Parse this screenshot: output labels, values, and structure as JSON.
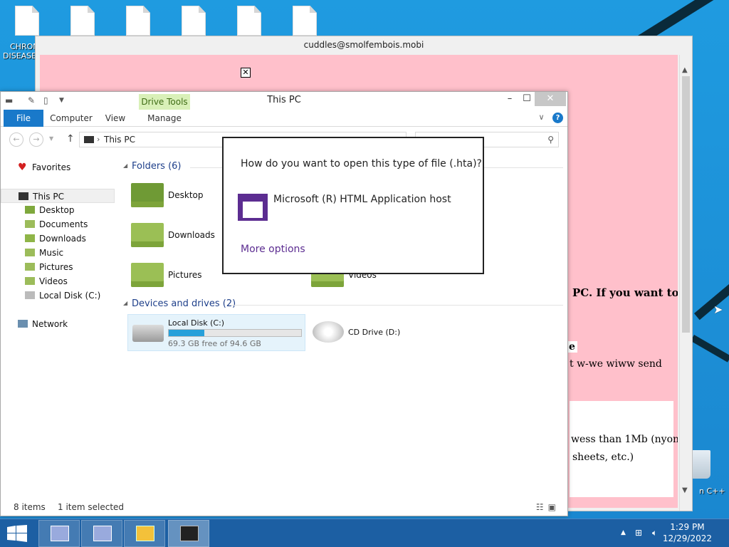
{
  "desktop": {
    "left_labels": [
      "CHRON",
      "DISEASE"
    ],
    "partial_label": "n C++"
  },
  "hta_window": {
    "title": "cuddles@smolfembois.mobi",
    "close_box_icon": "boxed-x-icon",
    "fragments": {
      "line1": "PC. If you want to",
      "line2": "e",
      "line3": "t w-we wiww send",
      "line4": "wess than 1Mb (nyon",
      "line5": "sheets, etc.)"
    }
  },
  "explorer": {
    "title": "This PC",
    "contextual_tab": "Drive Tools",
    "ribbon_tabs": [
      "File",
      "Computer",
      "View",
      "Manage"
    ],
    "address_path": "This PC",
    "navigation": {
      "favorites": "Favorites",
      "this_pc": "This PC",
      "items": [
        "Desktop",
        "Documents",
        "Downloads",
        "Music",
        "Pictures",
        "Videos",
        "Local Disk (C:)"
      ],
      "network": "Network"
    },
    "folders_header": "Folders (6)",
    "folders": [
      "Desktop",
      "Downloads",
      "Pictures",
      "Videos"
    ],
    "devices_header": "Devices and drives (2)",
    "drives": {
      "local_name": "Local Disk (C:)",
      "local_free": "69.3 GB free of 94.6 GB",
      "local_used_fraction": 0.27,
      "cd_name": "CD Drive (D:)"
    },
    "status": {
      "items": "8 items",
      "selected": "1 item selected"
    }
  },
  "dialog": {
    "question": "How do you want to open this type of file (.hta)?",
    "app_name": "Microsoft (R) HTML Application host",
    "more_options": "More options"
  },
  "taskbar": {
    "time": "1:29 PM",
    "date": "12/29/2022"
  },
  "colors": {
    "accent": "#1979ca",
    "dialog_accent": "#5c2d91",
    "hta_background": "#ffc0cb",
    "taskbar": "#1c5fa3"
  }
}
